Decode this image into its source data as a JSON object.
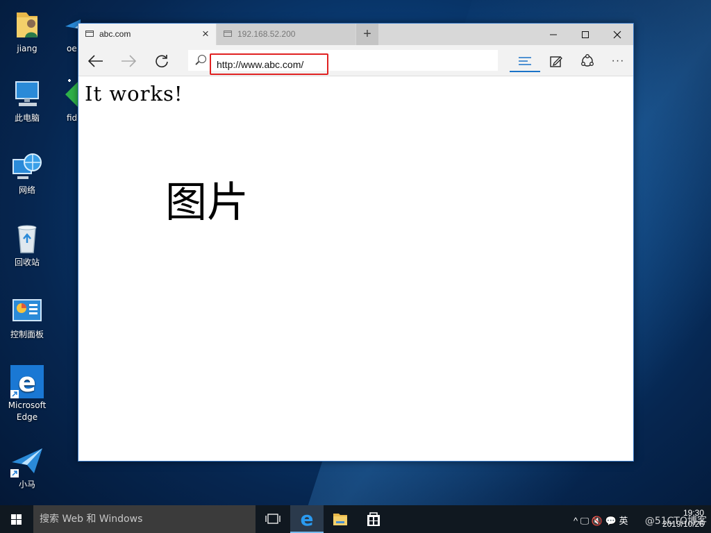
{
  "desktop": {
    "icons": [
      {
        "label": "jiang"
      },
      {
        "label": "此电脑"
      },
      {
        "label": "网络"
      },
      {
        "label": "回收站"
      },
      {
        "label": "控制面板"
      },
      {
        "label": "Microsoft Edge"
      },
      {
        "label": "小马"
      },
      {
        "label": "oe"
      },
      {
        "label": "fid"
      }
    ]
  },
  "browser": {
    "tabs": [
      {
        "title": "abc.com",
        "active": true,
        "close": "×"
      },
      {
        "title": "192.168.52.200",
        "active": false
      }
    ],
    "new_tab": "+",
    "window_controls": {
      "minimize": "—",
      "maximize": "☐",
      "close": "✕"
    },
    "nav": {
      "back": "←",
      "forward": "→",
      "refresh": "↻"
    },
    "address": {
      "value": "http://www.abc.com/",
      "highlight_color": "#e02020"
    },
    "right_tools": {
      "hub": "≡",
      "note": "✎",
      "share": "♲",
      "more": "···"
    },
    "page": {
      "heading": "It works!",
      "overlay_text": "图片"
    }
  },
  "taskbar": {
    "search_placeholder": "搜索 Web 和 Windows",
    "tray_text": "^ 🖵 🔇 💬 英",
    "time": "19:30",
    "date": "2019/10/26",
    "watermark": "@51CTO博客"
  },
  "colors": {
    "accent": "#1a73c8",
    "url_highlight": "#e02020",
    "taskbar": "#101820"
  }
}
